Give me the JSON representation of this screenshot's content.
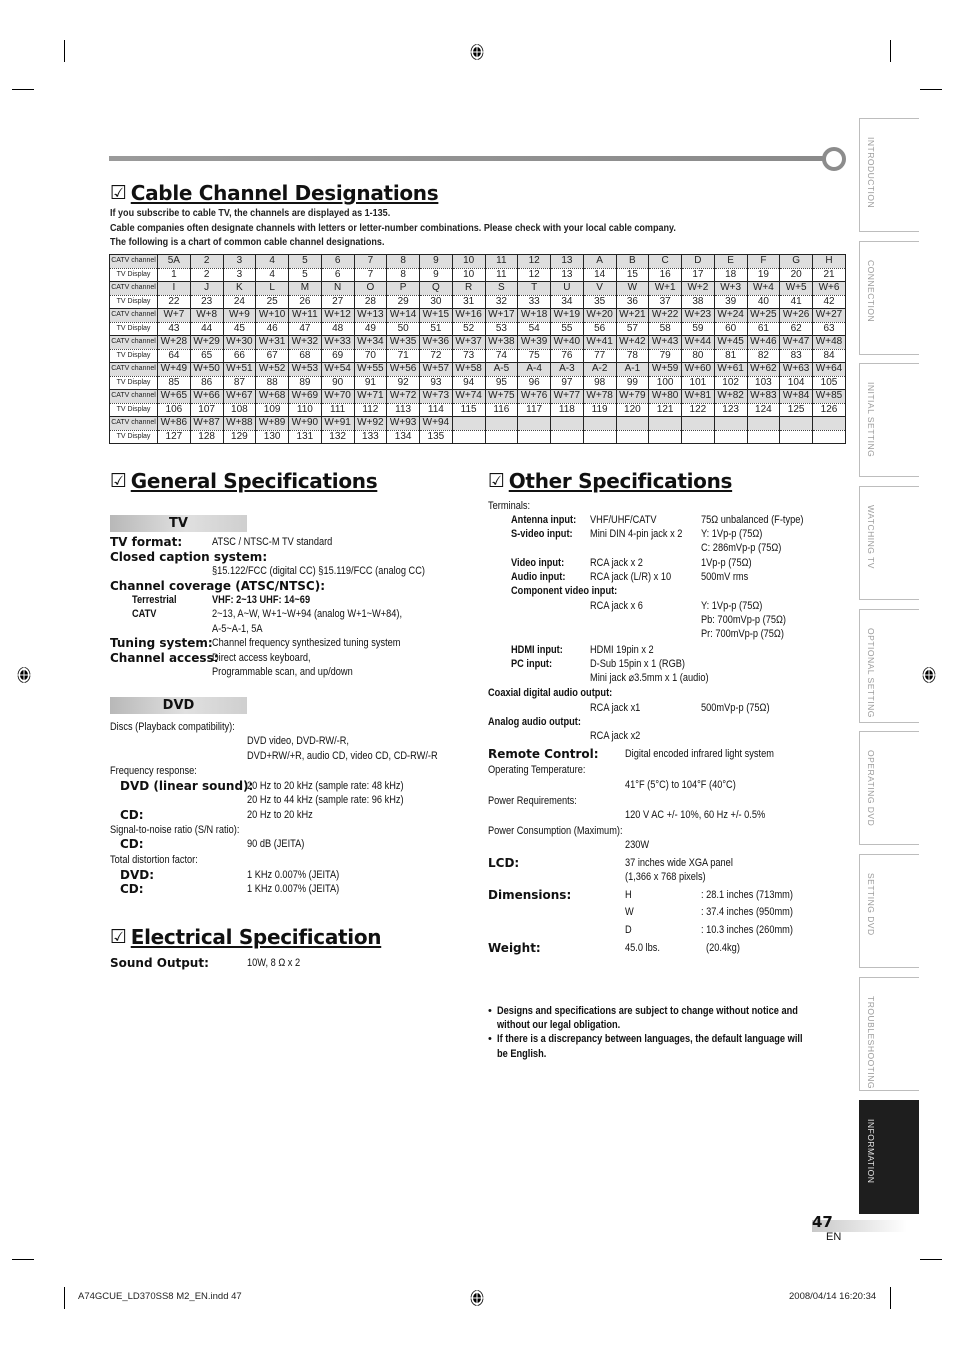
{
  "cable": {
    "title": "Cable Channel Designations",
    "intro": [
      "If you subscribe to cable TV, the channels are displayed as 1-135.",
      "Cable companies often designate channels with letters or letter-number combinations. Please check with your local cable company.",
      "The following is a chart of common cable channel designations."
    ],
    "row_labels": {
      "catv": "CATV channel",
      "display": "TV Display"
    },
    "table": [
      {
        "catv": [
          "5A",
          "2",
          "3",
          "4",
          "5",
          "6",
          "7",
          "8",
          "9",
          "10",
          "11",
          "12",
          "13",
          "A",
          "B",
          "C",
          "D",
          "E",
          "F",
          "G",
          "H"
        ],
        "display": [
          "1",
          "2",
          "3",
          "4",
          "5",
          "6",
          "7",
          "8",
          "9",
          "10",
          "11",
          "12",
          "13",
          "14",
          "15",
          "16",
          "17",
          "18",
          "19",
          "20",
          "21"
        ]
      },
      {
        "catv": [
          "I",
          "J",
          "K",
          "L",
          "M",
          "N",
          "O",
          "P",
          "Q",
          "R",
          "S",
          "T",
          "U",
          "V",
          "W",
          "W+1",
          "W+2",
          "W+3",
          "W+4",
          "W+5",
          "W+6"
        ],
        "display": [
          "22",
          "23",
          "24",
          "25",
          "26",
          "27",
          "28",
          "29",
          "30",
          "31",
          "32",
          "33",
          "34",
          "35",
          "36",
          "37",
          "38",
          "39",
          "40",
          "41",
          "42"
        ]
      },
      {
        "catv": [
          "W+7",
          "W+8",
          "W+9",
          "W+10",
          "W+11",
          "W+12",
          "W+13",
          "W+14",
          "W+15",
          "W+16",
          "W+17",
          "W+18",
          "W+19",
          "W+20",
          "W+21",
          "W+22",
          "W+23",
          "W+24",
          "W+25",
          "W+26",
          "W+27"
        ],
        "display": [
          "43",
          "44",
          "45",
          "46",
          "47",
          "48",
          "49",
          "50",
          "51",
          "52",
          "53",
          "54",
          "55",
          "56",
          "57",
          "58",
          "59",
          "60",
          "61",
          "62",
          "63"
        ]
      },
      {
        "catv": [
          "W+28",
          "W+29",
          "W+30",
          "W+31",
          "W+32",
          "W+33",
          "W+34",
          "W+35",
          "W+36",
          "W+37",
          "W+38",
          "W+39",
          "W+40",
          "W+41",
          "W+42",
          "W+43",
          "W+44",
          "W+45",
          "W+46",
          "W+47",
          "W+48"
        ],
        "display": [
          "64",
          "65",
          "66",
          "67",
          "68",
          "69",
          "70",
          "71",
          "72",
          "73",
          "74",
          "75",
          "76",
          "77",
          "78",
          "79",
          "80",
          "81",
          "82",
          "83",
          "84"
        ]
      },
      {
        "catv": [
          "W+49",
          "W+50",
          "W+51",
          "W+52",
          "W+53",
          "W+54",
          "W+55",
          "W+56",
          "W+57",
          "W+58",
          "A-5",
          "A-4",
          "A-3",
          "A-2",
          "A-1",
          "W+59",
          "W+60",
          "W+61",
          "W+62",
          "W+63",
          "W+64"
        ],
        "display": [
          "85",
          "86",
          "87",
          "88",
          "89",
          "90",
          "91",
          "92",
          "93",
          "94",
          "95",
          "96",
          "97",
          "98",
          "99",
          "100",
          "101",
          "102",
          "103",
          "104",
          "105"
        ]
      },
      {
        "catv": [
          "W+65",
          "W+66",
          "W+67",
          "W+68",
          "W+69",
          "W+70",
          "W+71",
          "W+72",
          "W+73",
          "W+74",
          "W+75",
          "W+76",
          "W+77",
          "W+78",
          "W+79",
          "W+80",
          "W+81",
          "W+82",
          "W+83",
          "W+84",
          "W+85"
        ],
        "display": [
          "106",
          "107",
          "108",
          "109",
          "110",
          "111",
          "112",
          "113",
          "114",
          "115",
          "116",
          "117",
          "118",
          "119",
          "120",
          "121",
          "122",
          "123",
          "124",
          "125",
          "126"
        ]
      },
      {
        "catv": [
          "W+86",
          "W+87",
          "W+88",
          "W+89",
          "W+90",
          "W+91",
          "W+92",
          "W+93",
          "W+94",
          "",
          "",
          "",
          "",
          "",
          "",
          "",
          "",
          "",
          "",
          "",
          ""
        ],
        "display": [
          "127",
          "128",
          "129",
          "130",
          "131",
          "132",
          "133",
          "134",
          "135",
          "",
          "",
          "",
          "",
          "",
          "",
          "",
          "",
          "",
          "",
          "",
          ""
        ]
      }
    ]
  },
  "general": {
    "title": "General Specifications",
    "tv_band": "TV",
    "tv_format_label": "TV format:",
    "tv_format_value": "ATSC / NTSC-M TV standard",
    "cc_label": "Closed caption system:",
    "cc_value": "§15.122/FCC (digital CC)    §15.119/FCC (analog CC)",
    "coverage_label": "Channel coverage (ATSC/NTSC):",
    "terrestrial_label": "Terrestrial",
    "terrestrial_value": "VHF: 2~13    UHF:  14~69",
    "catv_label": "CATV",
    "catv_value_1": "2~13, A~W, W+1~W+94 (analog W+1~W+84),",
    "catv_value_2": "A-5~A-1, 5A",
    "tuning_label": "Tuning system:",
    "tuning_value": "Channel frequency synthesized tuning system",
    "access_label": "Channel access:",
    "access_value_1": "Direct access keyboard,",
    "access_value_2": "Programmable scan, and up/down",
    "dvd_band": "DVD",
    "discs_label": "Discs (Playback compatibility):",
    "discs_value_1": "DVD video, DVD-RW/-R,",
    "discs_value_2": "DVD+RW/+R, audio CD, video CD, CD-RW/-R",
    "freq_label": "Frequency response:",
    "freq_dvd_label": "DVD (linear sound):",
    "freq_dvd_value_1": "20 Hz to 20 kHz (sample rate: 48 kHz)",
    "freq_dvd_value_2": "20 Hz to 44 kHz (sample rate: 96 kHz)",
    "freq_cd_label": "CD:",
    "freq_cd_value": "20 Hz to 20 kHz",
    "sn_label": "Signal-to-noise ratio (S/N ratio):",
    "sn_cd_label": "CD:",
    "sn_cd_value": "90 dB (JEITA)",
    "tdf_label": "Total distortion factor:",
    "tdf_dvd_label": "DVD:",
    "tdf_dvd_value": "1 KHz  0.007% (JEITA)",
    "tdf_cd_label": "CD:",
    "tdf_cd_value": "1 KHz  0.007% (JEITA)"
  },
  "electrical": {
    "title": "Electrical Specification",
    "sound_label": "Sound Output:",
    "sound_value": "10W, 8 Ω x 2"
  },
  "other": {
    "title": "Other Specifications",
    "terminals_label": "Terminals:",
    "antenna_label": "Antenna input:",
    "antenna_value": "VHF/UHF/CATV",
    "antenna_spec": "75Ω unbalanced (F-type)",
    "svideo_label": "S-video input:",
    "svideo_value": "Mini DIN 4-pin jack x 2",
    "svideo_spec_1": "Y: 1Vp-p (75Ω)",
    "svideo_spec_2": "C: 286mVp-p (75Ω)",
    "video_label": "Video input:",
    "video_value": "RCA jack x 2",
    "video_spec": "1Vp-p (75Ω)",
    "audio_label": "Audio input:",
    "audio_value": "RCA jack (L/R) x 10",
    "audio_spec": "500mV rms",
    "component_label": "Component video input:",
    "component_value": "RCA jack x 6",
    "component_y": "Y:   1Vp-p (75Ω)",
    "component_pb": "Pb: 700mVp-p (75Ω)",
    "component_pr": "Pr:  700mVp-p (75Ω)",
    "hdmi_label": "HDMI input:",
    "hdmi_value": "HDMI 19pin x 2",
    "pc_label": "PC input:",
    "pc_value_1": "D-Sub 15pin x 1 (RGB)",
    "pc_value_2": "Mini jack ⌀3.5mm x 1 (audio)",
    "coax_label": "Coaxial digital audio output:",
    "coax_value": "RCA jack x1",
    "coax_spec": "500mVp-p (75Ω)",
    "analog_label": "Analog audio output:",
    "analog_value": "RCA jack x2",
    "remote_label": "Remote Control:",
    "remote_value": "Digital encoded infrared light system",
    "optemp_label": "Operating Temperature:",
    "optemp_value": "41°F (5°C) to 104°F (40°C)",
    "power_label": "Power Requirements:",
    "power_value": "120 V AC +/- 10%, 60 Hz +/- 0.5%",
    "consumption_label": "Power Consumption (Maximum):",
    "consumption_value": "230W",
    "lcd_label": "LCD:",
    "lcd_value_1": "37 inches wide XGA panel",
    "lcd_value_2": "(1,366 x 768 pixels)",
    "dim_label": "Dimensions:",
    "dim_h": "H",
    "dim_h_value": ": 28.1 inches   (713mm)",
    "dim_w": "W",
    "dim_w_value": ": 37.4 inches   (950mm)",
    "dim_d": "D",
    "dim_d_value": ": 10.3 inches   (260mm)",
    "weight_label": "Weight:",
    "weight_value": "45.0 lbs.",
    "weight_metric": "(20.4kg)",
    "notes": [
      "Designs and specifications are subject to change without notice and",
      "without our legal obligation.",
      "If there is a discrepancy between languages, the default language will",
      "be English."
    ]
  },
  "side_tabs": [
    "INTRODUCTION",
    "CONNECTION",
    "INITIAL  SETTING",
    "WATCHING  TV",
    "OPTIONAL  SETTING",
    "OPERATING  DVD",
    "SETTING  DVD",
    "TROUBLESHOOTING",
    "INFORMATION"
  ],
  "active_tab": "INFORMATION",
  "page_number": "47",
  "page_lang": "EN",
  "footer": {
    "file": "A74GCUE_LD370SS8 M2_EN.indd   47",
    "timestamp": "2008/04/14   16:20:34"
  }
}
